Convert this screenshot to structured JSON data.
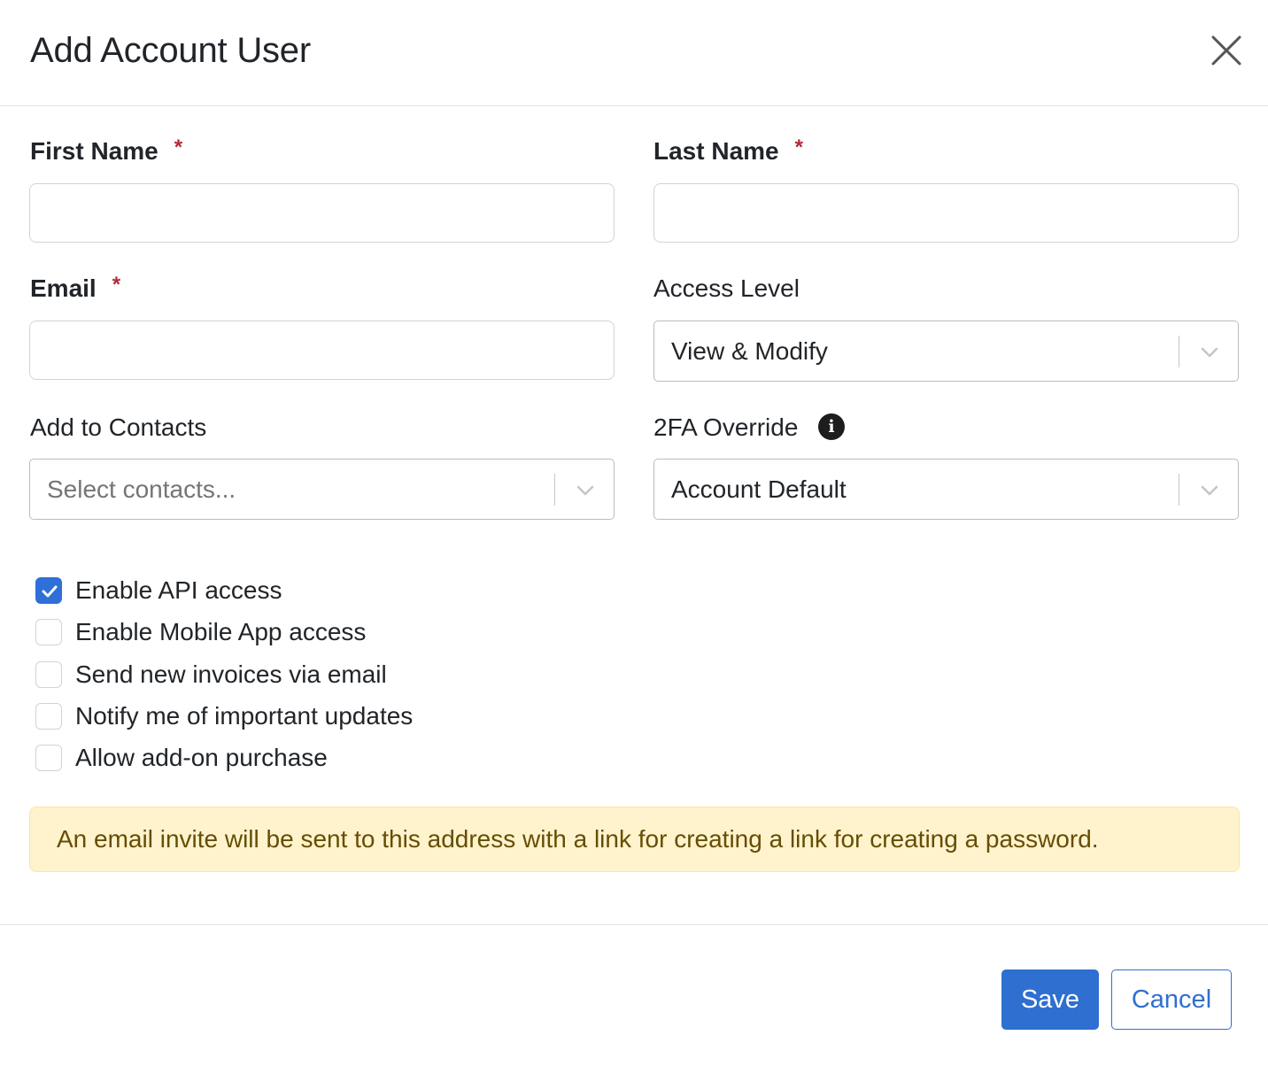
{
  "modal": {
    "title": "Add Account User"
  },
  "form": {
    "first_name": {
      "label": "First Name",
      "required_mark": "*",
      "value": "",
      "placeholder": ""
    },
    "last_name": {
      "label": "Last Name",
      "required_mark": "*",
      "value": "",
      "placeholder": ""
    },
    "email": {
      "label": "Email",
      "required_mark": "*",
      "value": "",
      "placeholder": ""
    },
    "access_level": {
      "label": "Access Level",
      "selected": "View & Modify"
    },
    "add_to_contacts": {
      "label": "Add to Contacts",
      "placeholder": "Select contacts..."
    },
    "twofa_override": {
      "label": "2FA Override",
      "info_glyph": "i",
      "selected": "Account Default"
    }
  },
  "checkboxes": [
    {
      "label": "Enable API access",
      "checked": true
    },
    {
      "label": "Enable Mobile App access",
      "checked": false
    },
    {
      "label": "Send new invoices via email",
      "checked": false
    },
    {
      "label": "Notify me of important updates",
      "checked": false
    },
    {
      "label": "Allow add-on purchase",
      "checked": false
    }
  ],
  "alert": {
    "text": "An email invite will be sent to this address with a link for creating a link for creating a password."
  },
  "footer": {
    "save_label": "Save",
    "cancel_label": "Cancel"
  },
  "colors": {
    "primary": "#2f6fd0",
    "required": "#b02a37",
    "alert_bg": "#fff3cd",
    "alert_text": "#664d03"
  }
}
